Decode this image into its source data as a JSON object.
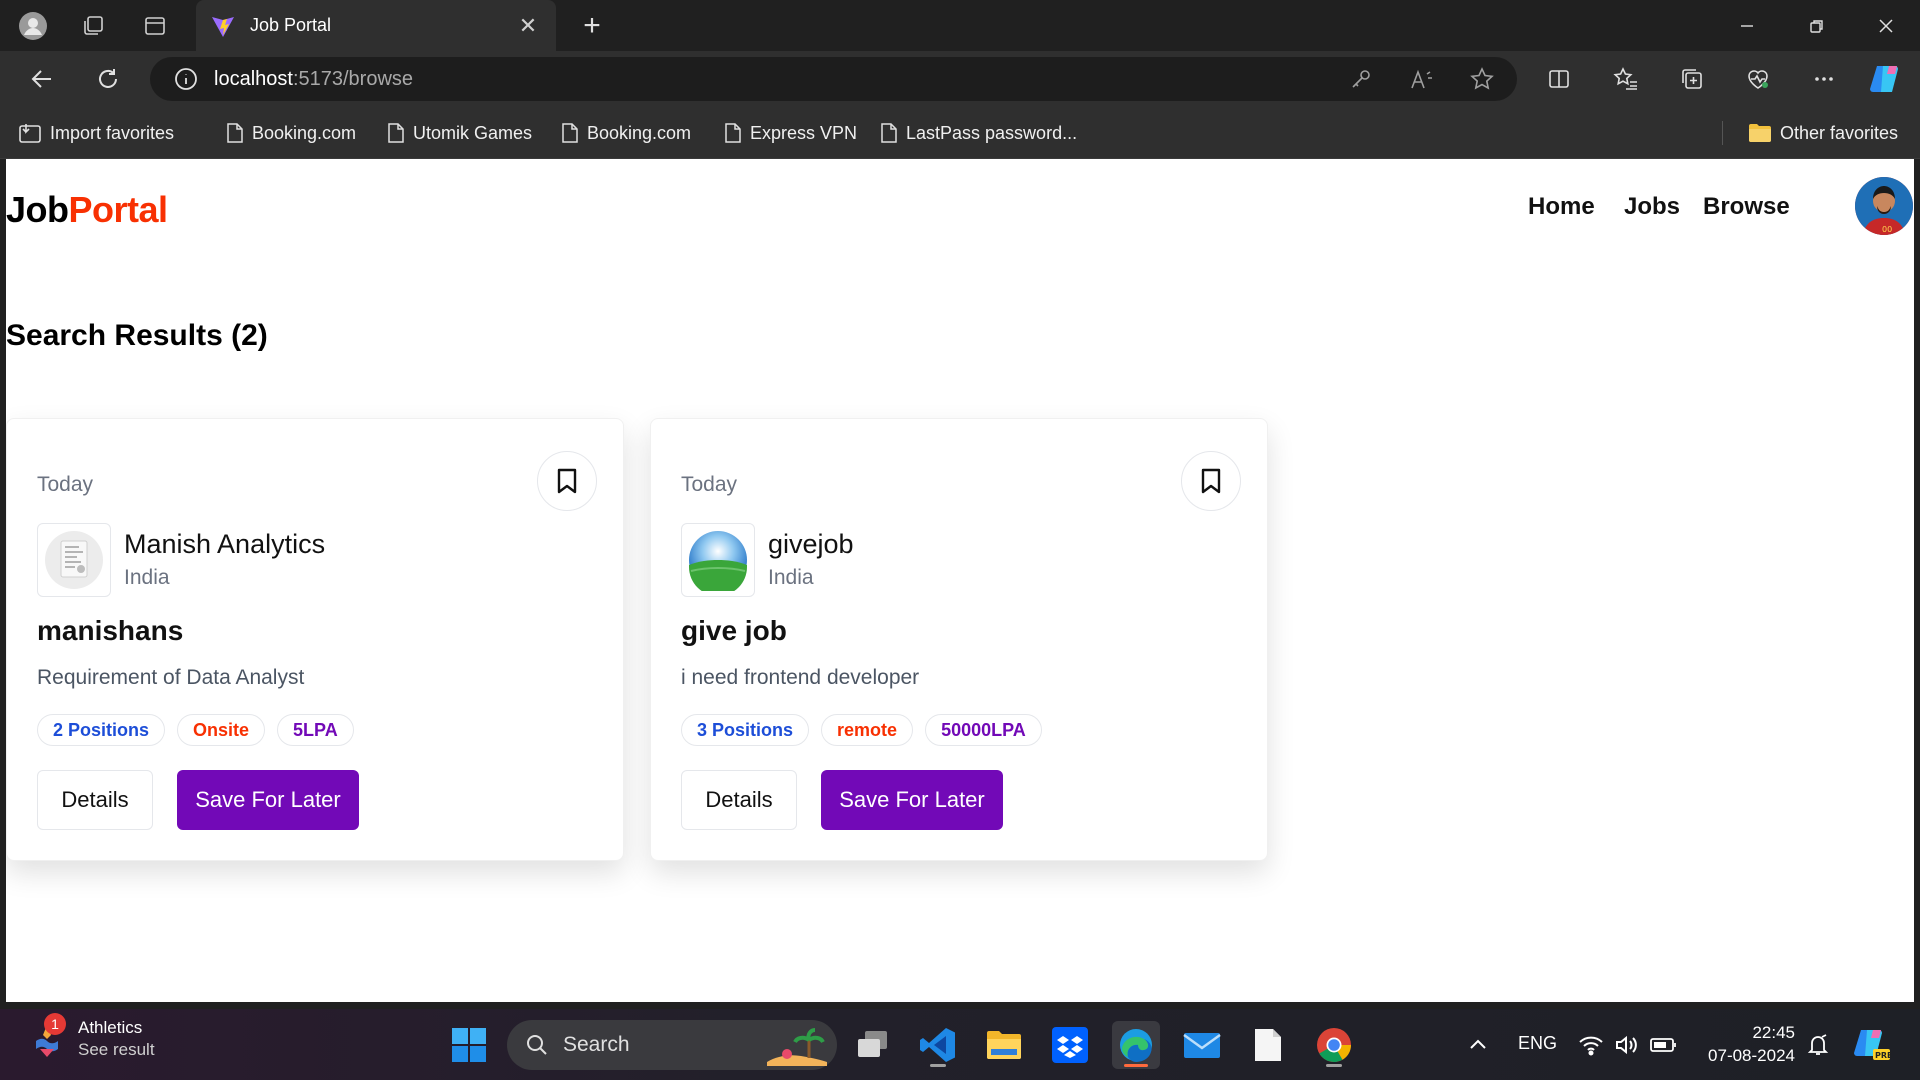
{
  "browser": {
    "tab_title": "Job Portal",
    "url_host": "localhost",
    "url_path": ":5173/browse",
    "favorites": [
      {
        "label": "Import favorites",
        "icon": "import-icon"
      },
      {
        "label": "Booking.com",
        "icon": "page-icon"
      },
      {
        "label": "Utomik Games",
        "icon": "page-icon"
      },
      {
        "label": "Booking.com",
        "icon": "page-icon"
      },
      {
        "label": "Express VPN",
        "icon": "page-icon"
      },
      {
        "label": "LastPass password...",
        "icon": "page-icon"
      }
    ],
    "other_favorites": "Other favorites"
  },
  "site": {
    "brand_primary": "Job",
    "brand_accent": "Portal",
    "accent_color": "#f83002",
    "primary_color": "#7209b7",
    "nav": [
      "Home",
      "Jobs",
      "Browse"
    ]
  },
  "results": {
    "heading": "Search Results (2)",
    "jobs": [
      {
        "posted": "Today",
        "company": "Manish Analytics",
        "location": "India",
        "title": "manishans",
        "description": "Requirement of Data Analyst",
        "positions": "2 Positions",
        "job_type": "Onsite",
        "salary": "5LPA",
        "details_label": "Details",
        "save_label": "Save For Later"
      },
      {
        "posted": "Today",
        "company": "givejob",
        "location": "India",
        "title": "give job",
        "description": "i need frontend developer",
        "positions": "3 Positions",
        "job_type": "remote",
        "salary": "50000LPA",
        "details_label": "Details",
        "save_label": "Save For Later"
      }
    ]
  },
  "taskbar": {
    "weather_title": "Athletics",
    "weather_sub": "See result",
    "notification_count": "1",
    "search_label": "Search",
    "language": "ENG",
    "time": "22:45",
    "date": "07-08-2024"
  }
}
